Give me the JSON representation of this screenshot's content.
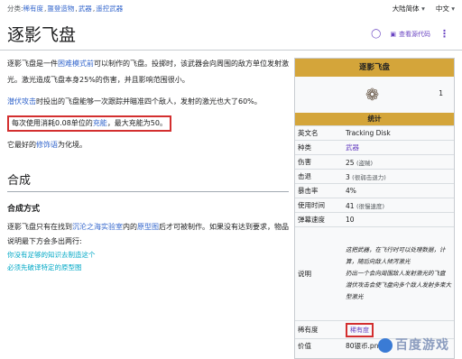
{
  "topbar": {
    "categories_label": "分类:",
    "categories": [
      "稀有度",
      "噩登造物",
      "武器",
      "遥控武器"
    ],
    "language_variant": "大陆简体",
    "language": "中文"
  },
  "header": {
    "title": "逐影飞盘",
    "view_source_label": "查看源代码"
  },
  "content": {
    "p1_prefix": "逐影飞盘是一件",
    "p1_link": "困难模式前",
    "p1_suffix": "可以制作的飞盘。投掷时，该武器会向周围的敌方单位发射激光。激光造成飞盘本身25%的伤害，并且影响范围很小。",
    "p2_link": "潜伏攻击",
    "p2_suffix": "时投出的飞盘能够一次跟踪并瞄准四个敌人，发射的激光也大了60%。",
    "p3_prefix": "每次使用消耗0.08单位的",
    "p3_link": "充能",
    "p3_suffix": "，最大充能为50。",
    "p4_prefix": "它最好的",
    "p4_link": "修饰语",
    "p4_suffix": "为化境。",
    "h2": "合成",
    "h3": "合成方式",
    "p5_prefix": "逐影飞盘只有在找到",
    "p5_link1": "沉沦之海实验室",
    "p5_mid": "内的",
    "p5_link2": "原型图",
    "p5_suffix": "后才可被制作。如果没有达到要求，物品说明最下方会多出两行:",
    "hint1": "你没有足够的知识去制造这个",
    "hint2": "必须先破译特定的原型图"
  },
  "infobox": {
    "name": "逐影飞盘",
    "count": "1",
    "stats_header": "统计",
    "rows": [
      {
        "key": "英文名",
        "value": "Tracking Disk"
      },
      {
        "key": "种类",
        "value": "武器"
      },
      {
        "key": "伤害",
        "value": "25",
        "note": "(盗贼)"
      },
      {
        "key": "击退",
        "value": "3",
        "note": "(很弱击退力)"
      },
      {
        "key": "暴击率",
        "value": "4%"
      },
      {
        "key": "使用时间",
        "value": "41",
        "note": "(很慢速度)"
      },
      {
        "key": "弹幕速度",
        "value": "10"
      }
    ],
    "desc_key": "说明",
    "desc_lines": [
      "这把武器，在飞行时可以处理数据，计算，随后向敌人倾泻激光",
      "扔出一个会向周围敌人发射激光的飞盘",
      "潜伏攻击会使飞盘向多个敌人发射多束大型激光"
    ],
    "rarity_key": "稀有度",
    "rarity_value": "稀有度",
    "price_key": "价值",
    "price_value": "80银币.png"
  },
  "watermark": "百度游戏"
}
